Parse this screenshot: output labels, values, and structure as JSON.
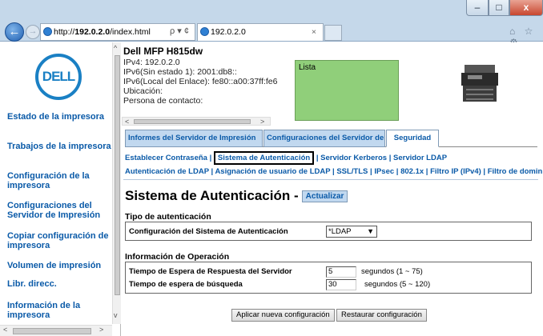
{
  "browser": {
    "address_prefix": "http://",
    "address_host": "192.0.2.0",
    "address_path": "/index.html",
    "address_tools": "ρ ▾ ¢",
    "tab_title": "192.0.2.0",
    "tab_close": "×",
    "min": "–",
    "max": "□",
    "close": "x",
    "toolbar_icons": "⌂ ☆ ⚙"
  },
  "sidebar": {
    "logo": "DELL",
    "items": [
      {
        "label": "Estado de la impresora"
      },
      {
        "label": "Trabajos de la impresora"
      },
      {
        "label": "Configuración de la impresora"
      },
      {
        "label": "Configuraciones del Servidor de Impresión"
      },
      {
        "label": "Copiar configuración de impresora"
      },
      {
        "label": "Volumen de impresión"
      },
      {
        "label": "Libr. direcc."
      },
      {
        "label": "Información de la impresora"
      }
    ]
  },
  "header": {
    "model": "Dell MFP H815dw",
    "lines": [
      "IPv4: 192.0.2.0",
      "IPv6(Sin estado 1): 2001:db8::",
      "IPv6(Local del Enlace): fe80::a00:37ff:fe6",
      "Ubicación:",
      "Persona de contacto:"
    ],
    "status": "Lista"
  },
  "tabs": [
    {
      "label": "Informes del Servidor de Impresión"
    },
    {
      "label": "Configuraciones del Servidor de Impresión"
    },
    {
      "label": "Seguridad"
    }
  ],
  "subnav": {
    "set_password": "Establecer Contraseña",
    "auth_system": "Sistema de Autenticación",
    "kerberos": "Servidor Kerberos",
    "ldap": "Servidor LDAP"
  },
  "subnav2": "Autenticación de LDAP | Asignación de usuario de LDAP | SSL/TLS | IPsec | 802.1x | Filtro IP (IPv4) | Filtro de dominio SMTP",
  "page": {
    "title": "Sistema de Autenticación -",
    "refresh": "Actualizar"
  },
  "auth_type": {
    "heading": "Tipo de autenticación",
    "label": "Configuración del Sistema de Autenticación",
    "value": "*LDAP"
  },
  "operation": {
    "heading": "Información de Operación",
    "timeout_label": "Tiempo de Espera de Respuesta del Servidor",
    "timeout_value": "5",
    "timeout_unit": "segundos (1 ~ 75)",
    "search_label": "Tiempo de espera de búsqueda",
    "search_value": "30",
    "search_unit": "segundos (5 ~ 120)"
  },
  "buttons": {
    "apply": "Aplicar nueva configuración",
    "restore": "Restaurar configuración"
  }
}
